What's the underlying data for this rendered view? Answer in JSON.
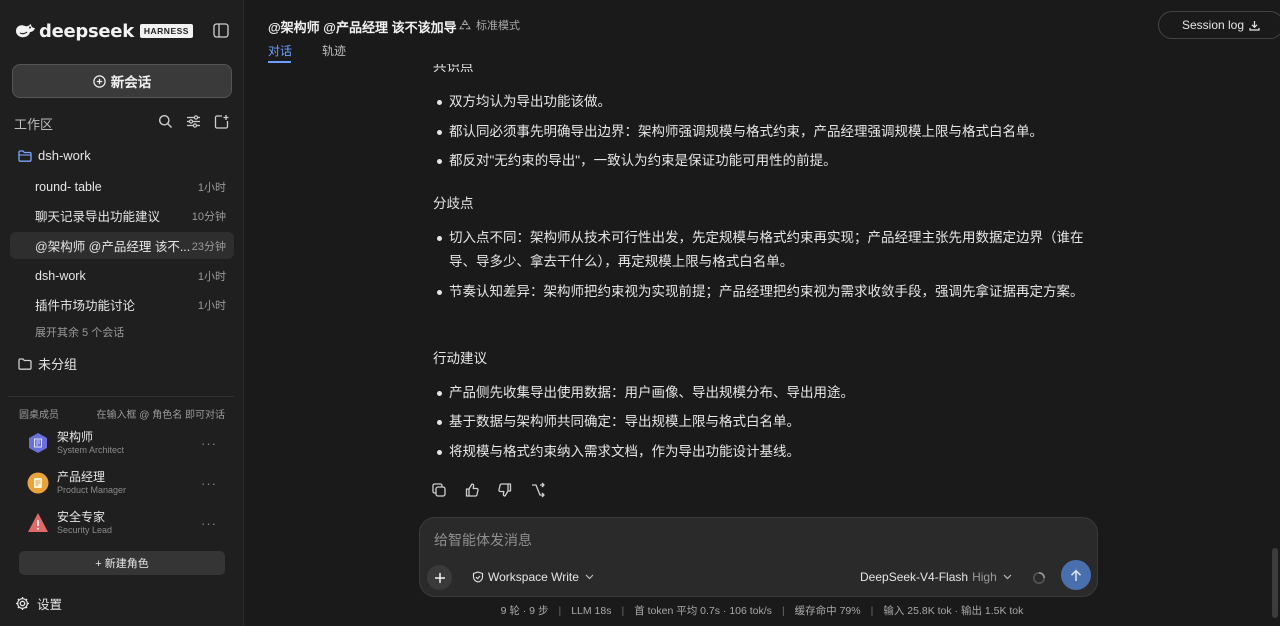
{
  "brand": {
    "name": "deepseek",
    "badge": "HARNESS"
  },
  "sidebar": {
    "new_chat_label": "新会话",
    "workspace_label": "工作区",
    "folder_main": "dsh-work",
    "sessions": [
      {
        "name": "round- table",
        "time": "1小时"
      },
      {
        "name": "聊天记录导出功能建议",
        "time": "10分钟"
      },
      {
        "name": "@架构师 @产品经理 该不...",
        "time": "23分钟"
      },
      {
        "name": "dsh-work",
        "time": "1小时"
      },
      {
        "name": "插件市场功能讨论",
        "time": "1小时"
      }
    ],
    "expand_more": "展开其余 5 个会话",
    "folder_ungrouped": "未分组",
    "members_title": "圆桌成员",
    "members_hint": "在输入框 @ 角色名 即可对话",
    "members": [
      {
        "name": "架构师",
        "role": "System Architect",
        "color": "#6b6fd8"
      },
      {
        "name": "产品经理",
        "role": "Product Manager",
        "color": "#e8a33a"
      },
      {
        "name": "安全专家",
        "role": "Security Lead",
        "color": "#e06a6a"
      }
    ],
    "member_more": "···",
    "new_role_label": "+ 新建角色",
    "settings_label": "设置"
  },
  "header": {
    "title": "@架构师 @产品经理 该不该加导",
    "mode": "标准模式",
    "tabs": [
      "对话",
      "轨迹"
    ],
    "session_log": "Session log"
  },
  "content": {
    "partial_heading": "共识点",
    "consensus": [
      "双方均认为导出功能该做。",
      "都认同必须事先明确导出边界：架构师强调规模与格式约束，产品经理强调规模上限与格式白名单。",
      "都反对\"无约束的导出\"，一致认为约束是保证功能可用性的前提。"
    ],
    "diff_heading": "分歧点",
    "differences": [
      "切入点不同：架构师从技术可行性出发，先定规模与格式约束再实现；产品经理主张先用数据定边界（谁在导、导多少、拿去干什么），再定规模上限与格式白名单。",
      "节奏认知差异：架构师把约束视为实现前提；产品经理把约束视为需求收敛手段，强调先拿证据再定方案。"
    ],
    "action_heading": "行动建议",
    "actions": [
      "产品侧先收集导出使用数据：用户画像、导出规模分布、导出用途。",
      "基于数据与架构师共同确定：导出规模上限与格式白名单。",
      "将规模与格式约束纳入需求文档，作为导出功能设计基线。"
    ]
  },
  "composer": {
    "placeholder": "给智能体发消息",
    "workspace_mode": "Workspace Write",
    "model": "DeepSeek-V4-Flash",
    "effort": "High"
  },
  "status": {
    "turns": "9 轮 · 9 步",
    "llm": "LLM 18s",
    "first_token": "首 token 平均 0.7s · 106 tok/s",
    "cache": "缓存命中 79%",
    "tokens": "输入 25.8K tok · 输出 1.5K tok"
  }
}
